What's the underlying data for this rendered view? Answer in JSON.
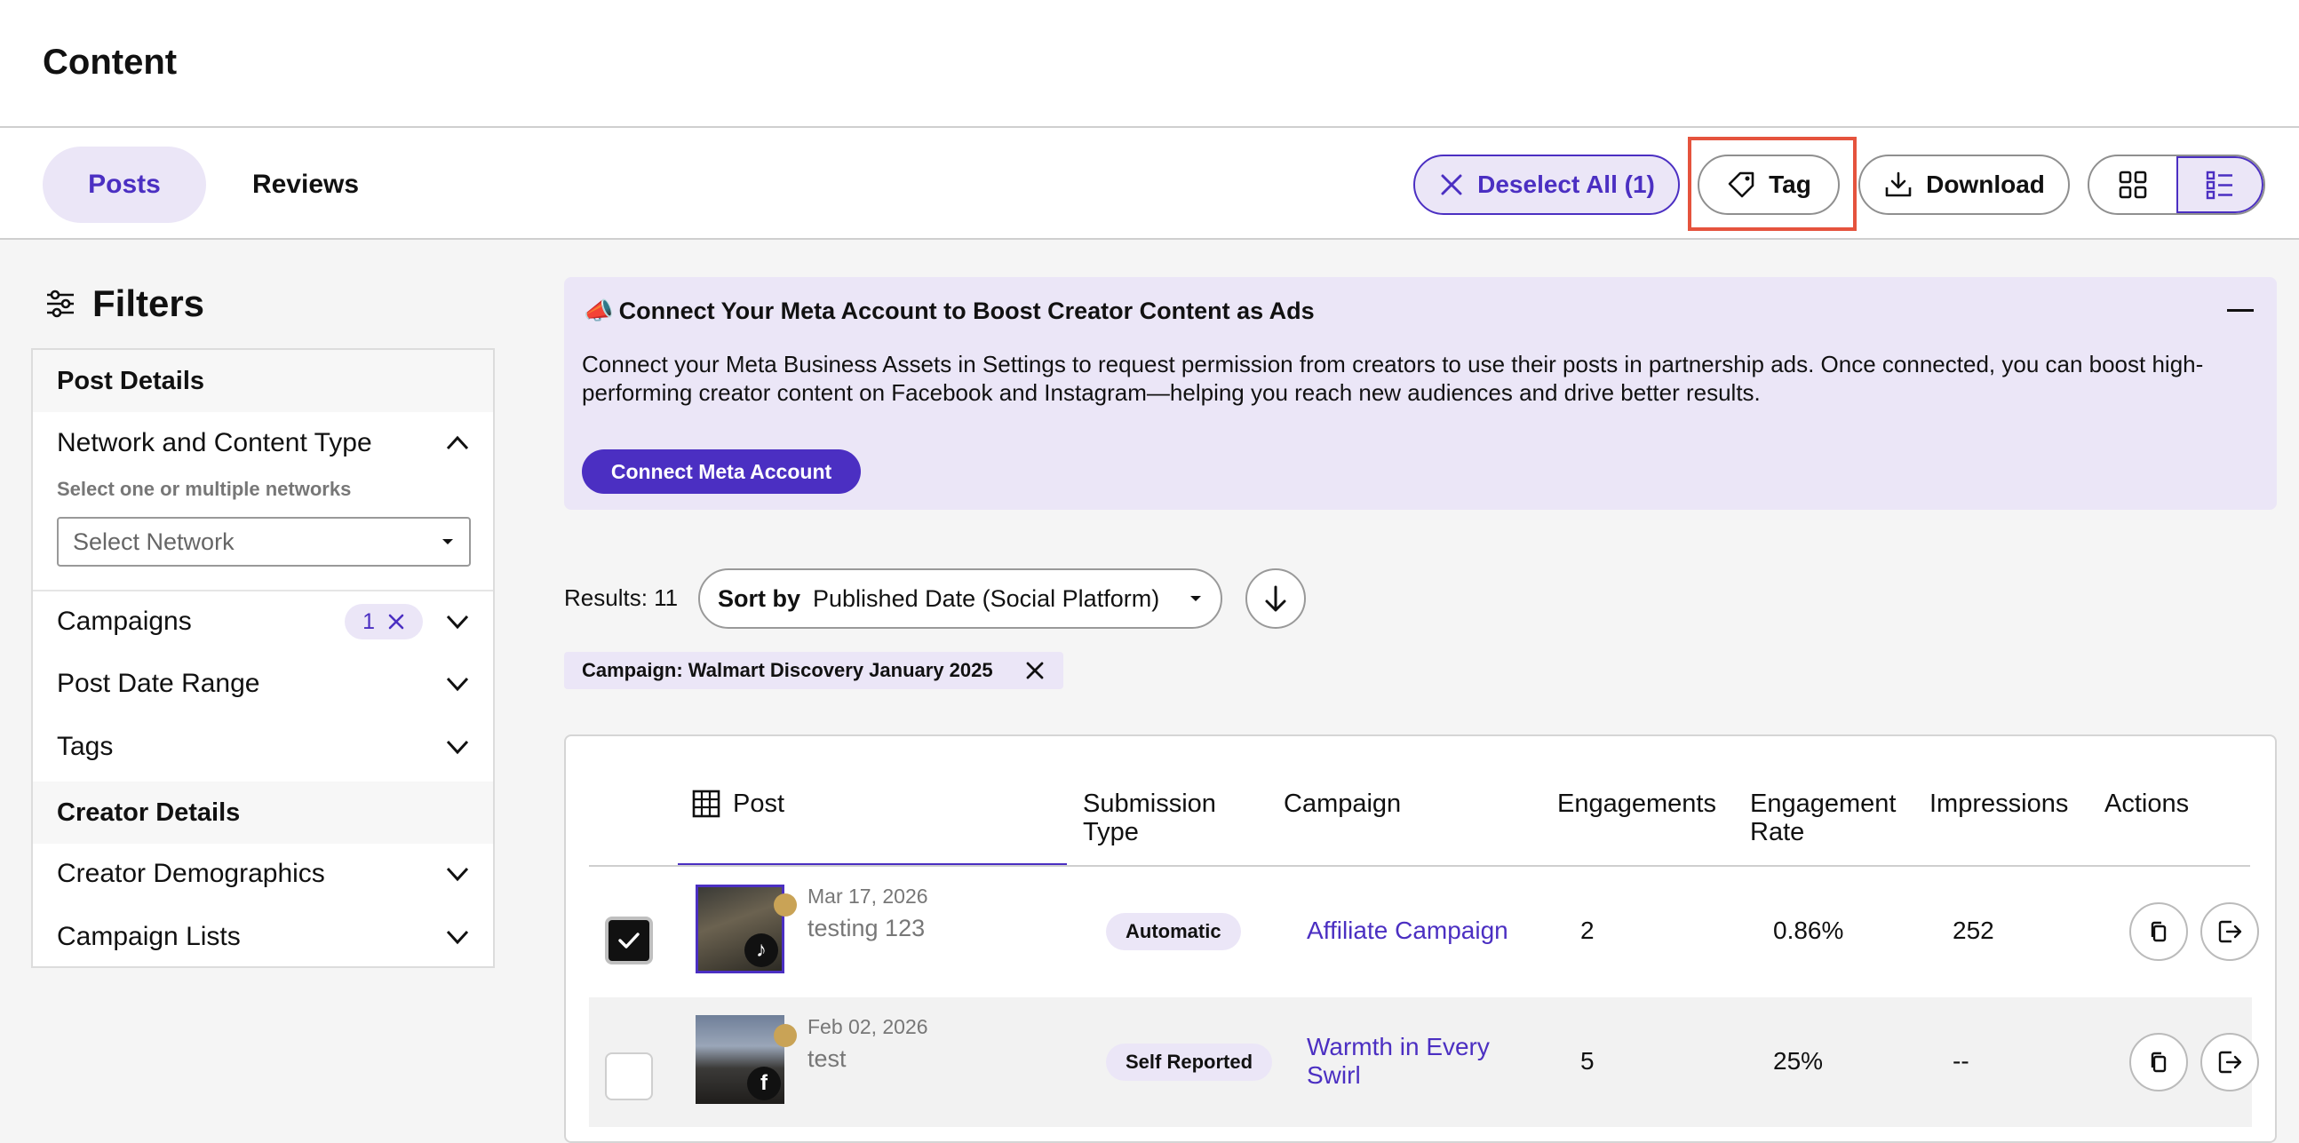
{
  "page": {
    "title": "Content"
  },
  "tabs": [
    {
      "label": "Posts",
      "active": true
    },
    {
      "label": "Reviews",
      "active": false
    }
  ],
  "toolbar": {
    "deselect_label": "Deselect All (1)",
    "tag_label": "Tag",
    "download_label": "Download",
    "view_mode": "list"
  },
  "filters": {
    "title": "Filters",
    "post_details_header": "Post Details",
    "network_label": "Network and Content Type",
    "network_help": "Select one or multiple networks",
    "network_placeholder": "Select Network",
    "campaigns_label": "Campaigns",
    "campaigns_count": "1",
    "post_date_label": "Post Date Range",
    "tags_label": "Tags",
    "creator_details_header": "Creator Details",
    "demographics_label": "Creator Demographics",
    "campaign_lists_label": "Campaign Lists"
  },
  "banner": {
    "icon": "📣",
    "title": "Connect Your Meta Account to Boost Creator Content as Ads",
    "body": "Connect your Meta Business Assets in Settings to request permission from creators to use their posts in partnership ads. Once connected, you can boost high-performing creator content on Facebook and Instagram—helping you reach new audiences and drive better results.",
    "button_label": "Connect Meta Account"
  },
  "results": {
    "label": "Results: 11",
    "sort_prefix": "Sort by",
    "sort_value": "Published Date (Social Platform)",
    "active_filter": "Campaign: Walmart Discovery January 2025"
  },
  "table": {
    "headers": {
      "post": "Post",
      "submission_type_1": "Submission",
      "submission_type_2": "Type",
      "campaign": "Campaign",
      "engagements": "Engagements",
      "engagement_rate_1": "Engagement",
      "engagement_rate_2": "Rate",
      "impressions": "Impressions",
      "actions": "Actions"
    },
    "rows": [
      {
        "date": "Mar 17, 2026",
        "title": "testing 123",
        "network": "tiktok",
        "submission_type": "Automatic",
        "campaign": "Affiliate Campaign",
        "engagements": "2",
        "engagement_rate": "0.86%",
        "impressions": "252",
        "selected": true
      },
      {
        "date": "Feb 02, 2026",
        "title": "test",
        "network": "facebook",
        "submission_type": "Self Reported",
        "campaign": "Warmth in Every Swirl",
        "engagements": "5",
        "engagement_rate": "25%",
        "impressions": "--",
        "selected": false
      }
    ]
  },
  "colors": {
    "accent": "#4b2fc2",
    "accent_bg": "#ebe6f7",
    "highlight": "#e5533d"
  }
}
